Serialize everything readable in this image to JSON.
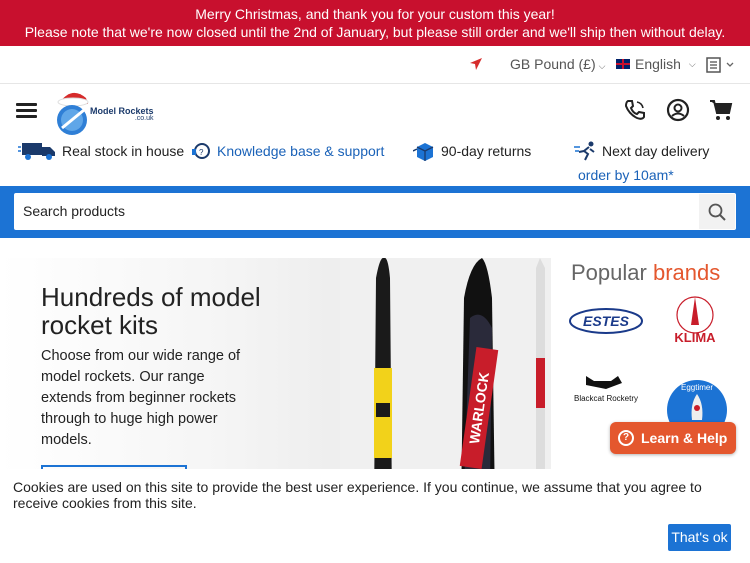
{
  "notice": {
    "line1": "Merry Christmas, and thank you for your custom this year!",
    "line2": "Please note that we're now closed until the 2nd of January, but please still order and we'll ship then without delay."
  },
  "topbar": {
    "currency": "GB Pound (£)",
    "language": "English"
  },
  "logo": {
    "name": "Model Rockets",
    "suffix": ".co.uk"
  },
  "usps": [
    {
      "text": "Real stock in house",
      "icon": "delivery-truck-icon"
    },
    {
      "text": "Knowledge base & support",
      "icon": "support-icon"
    },
    {
      "text": "90-day returns",
      "icon": "returns-box-icon"
    },
    {
      "text": "Next day delivery",
      "link": "order by 10am*",
      "icon": "runner-icon"
    }
  ],
  "search": {
    "placeholder": "Search products"
  },
  "hero": {
    "title": "Hundreds of model rocket kits",
    "body": "Choose from our wide range of model rockets. Our range extends from beginner rockets through to huge high power models."
  },
  "brands": {
    "title_a": "Popular",
    "title_b": "brands",
    "items": [
      {
        "name": "Estes",
        "label": "ESTES"
      },
      {
        "name": "Klima",
        "label": "KLIMA"
      },
      {
        "name": "Blackcat Rocketry",
        "label": "Blackcat Rocketry"
      },
      {
        "name": "Eggtimer",
        "label": "Eggtimer"
      }
    ]
  },
  "help": {
    "label": "Learn & Help"
  },
  "cookie": {
    "text": "Cookies are used on this site to provide the best user experience. If you continue, we assume that you agree to receive cookies from this site.",
    "button": "That's ok"
  },
  "colors": {
    "notice_red": "#c8102e",
    "brand_blue": "#1c73d4",
    "accent_orange": "#e4572e"
  }
}
